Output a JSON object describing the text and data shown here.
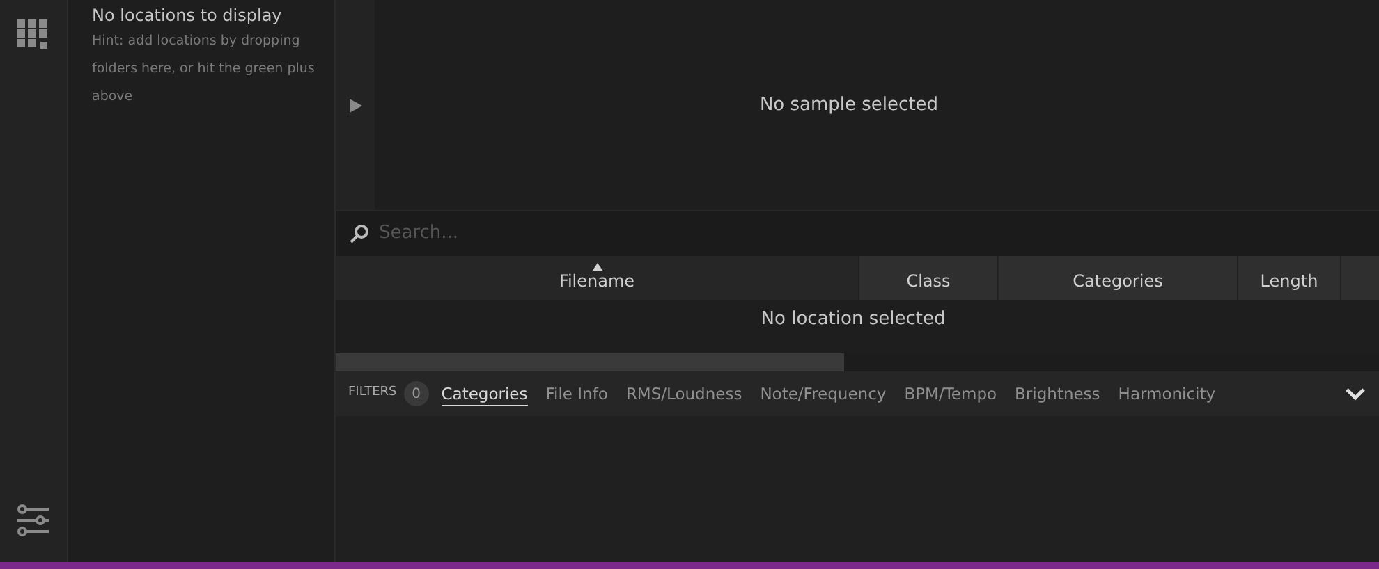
{
  "sidebar": {
    "title": "No locations to display",
    "hint": "Hint: add locations by dropping folders here, or hit the green plus above"
  },
  "preview": {
    "message": "No sample selected"
  },
  "search": {
    "placeholder": "Search..."
  },
  "table": {
    "columns": [
      {
        "label": "Filename",
        "sorted": true
      },
      {
        "label": "Class",
        "sorted": false
      },
      {
        "label": "Categories",
        "sorted": false
      },
      {
        "label": "Length",
        "sorted": false
      }
    ],
    "empty_message": "No location selected"
  },
  "filters": {
    "label": "FILTERS",
    "count": "0",
    "tabs": [
      {
        "label": "Categories",
        "selected": true
      },
      {
        "label": "File Info",
        "selected": false
      },
      {
        "label": "RMS/Loudness",
        "selected": false
      },
      {
        "label": "Note/Frequency",
        "selected": false
      },
      {
        "label": "BPM/Tempo",
        "selected": false
      },
      {
        "label": "Brightness",
        "selected": false
      },
      {
        "label": "Harmonicity",
        "selected": false
      }
    ]
  }
}
